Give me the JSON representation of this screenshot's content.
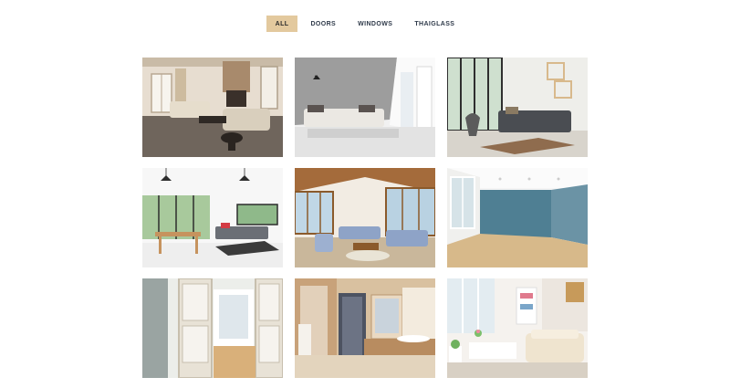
{
  "filters": [
    {
      "label": "ALL",
      "active": true
    },
    {
      "label": "DOORS",
      "active": false
    },
    {
      "label": "WINDOWS",
      "active": false
    },
    {
      "label": "THAIGLASS",
      "active": false
    }
  ],
  "colors": {
    "accent": "#e3c99e",
    "filter_text": "#2f3a4a",
    "accent_wall": "#4f7f93"
  },
  "gallery": [
    {
      "subject": "living-room-fireplace-photo"
    },
    {
      "subject": "minimal-grey-living-room-photo"
    },
    {
      "subject": "loft-living-room-with-shelves-photo"
    },
    {
      "subject": "bright-dining-living-room-photo"
    },
    {
      "subject": "wooden-ceiling-lounge-photo"
    },
    {
      "subject": "empty-blue-wall-room-photo"
    },
    {
      "subject": "open-french-doors-photo"
    },
    {
      "subject": "marble-bathroom-photo"
    },
    {
      "subject": "cream-sofa-living-room-photo"
    }
  ]
}
